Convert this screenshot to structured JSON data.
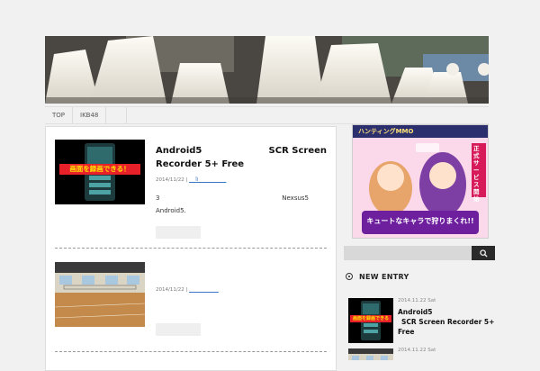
{
  "nav": {
    "items": [
      "TOP",
      "IKB48"
    ]
  },
  "posts": [
    {
      "title_line1_left": "Android5",
      "title_line1_right": "SCR Screen",
      "title_line2": "Recorder 5+ Free",
      "date": "2014/11/22",
      "meta_links": "__ l̄l__ ____ ____",
      "excerpt_left": "3",
      "excerpt_right": "Nexsus5",
      "excerpt_line2": "Android5.",
      "thumb_caption": "画面を録画できる！"
    },
    {
      "date": "2014/11/22",
      "meta_links": "__ ____ __ __"
    }
  ],
  "sidebar": {
    "ad": {
      "top_label": "ハンティングMMO",
      "side_label": "正式サービス開始",
      "bottom_label": "キュートなキャラで狩りまくれ!!"
    },
    "search": {
      "placeholder": ""
    },
    "heading": "NEW ENTRY",
    "entries": [
      {
        "date": "2014.11.22 Sat",
        "title_line1": "Android5",
        "title_line2": "SCR Screen Recorder 5+",
        "title_line3": "Free",
        "thumb_caption": "画面を録画できる"
      },
      {
        "date": "2014.11.22 Sat"
      }
    ]
  },
  "icons": {
    "search": "magnifier-icon",
    "heading_marker": "circle-marker-icon"
  },
  "colors": {
    "link": "#3a76c4",
    "search_button": "#2a2a2a",
    "thumb_caption_bg": "#e8202a",
    "thumb_caption_fg": "#ffe400"
  }
}
